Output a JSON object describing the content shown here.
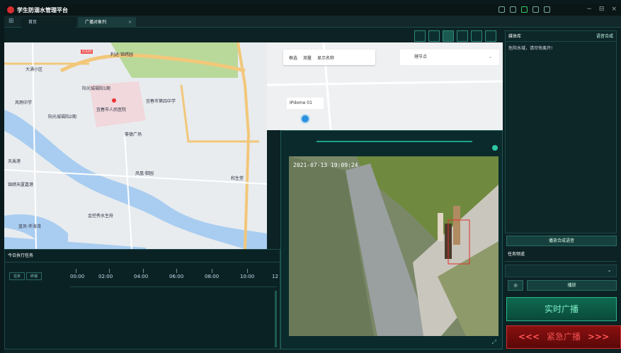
{
  "app": {
    "title": "学生防溺水管理平台",
    "tabs": [
      {
        "label": "首页"
      },
      {
        "label": "广播对象列",
        "close": "×"
      }
    ],
    "window_controls": {
      "minimize": "−",
      "restore": "⊟",
      "close": "×"
    }
  },
  "map": {
    "toolbar": {
      "frame_select": "框选",
      "measure": "测量",
      "show_name": "显示名称"
    },
    "select": {
      "value": "辖节点",
      "chevron": "⌄"
    },
    "camera_label": "IPdome 01",
    "place_labels": {
      "p1": "利达·锦绣园",
      "p2": "大涌小区",
      "p3": "阳光城福阳1期",
      "p4": "阳光城福阳2期",
      "p5": "宜春市人民医院",
      "p6": "宜春市第四中学",
      "p7": "凤凰·御园",
      "p8": "豪德广场",
      "p9": "和生堂",
      "p10": "金控秀水生府",
      "p11": "锦绣天厦嘉港",
      "p12": "天禹港",
      "p13": "风雨中学",
      "p14": "蓝凤·伴海湾",
      "road1": "G320"
    }
  },
  "video": {
    "timestamp": "2021-07-13 19:09:24"
  },
  "right_panel": {
    "media_library": {
      "title": "媒体库",
      "tts_label": "语音合成",
      "message": "危险水域，请尽快离开!"
    },
    "play_tts_button": "播放合成语音",
    "task_freq": {
      "title": "任务频道"
    },
    "play_button": "播放",
    "live_broadcast_button": "实时广播",
    "emergency_broadcast_button": "紧急广播",
    "emergency_arrows_left": "<<<",
    "emergency_arrows_right": ">>>"
  },
  "task_panel": {
    "title": "今日执行任务",
    "tabs": [
      {
        "label": "任务"
      },
      {
        "label": "终端"
      }
    ],
    "timeline_ticks": [
      "00:00",
      "02:00",
      "04:00",
      "06:00",
      "08:00",
      "10:00",
      "12"
    ]
  },
  "colors": {
    "accent": "#2ab88a",
    "danger": "#d03030",
    "panel_bg": "#0d2628"
  }
}
